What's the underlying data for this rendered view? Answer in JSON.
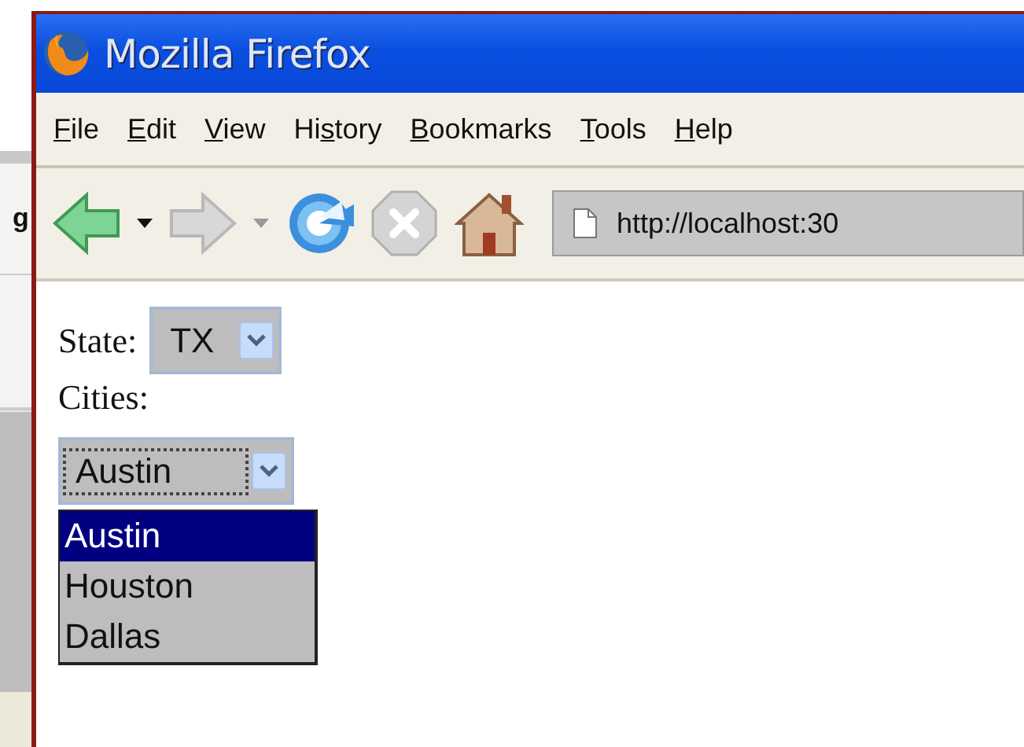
{
  "background_window": {
    "text": "g"
  },
  "window": {
    "title": "Mozilla Firefox"
  },
  "menu": [
    {
      "key": "F",
      "after": "ile"
    },
    {
      "key": "E",
      "after": "dit"
    },
    {
      "key": "V",
      "after": "iew"
    },
    {
      "before": "Hi",
      "key": "s",
      "after": "tory"
    },
    {
      "key": "B",
      "after": "ookmarks"
    },
    {
      "key": "T",
      "after": "ools"
    },
    {
      "key": "H",
      "after": "elp"
    }
  ],
  "toolbar": {
    "back_disabled": false,
    "forward_disabled": true,
    "stop_disabled": true,
    "address": "http://localhost:30"
  },
  "form": {
    "state_label": "State:",
    "state": "TX",
    "cities_label": "Cities:",
    "city": "Austin",
    "options": [
      {
        "label": "Austin",
        "selected": true
      },
      {
        "label": "Houston",
        "selected": false
      },
      {
        "label": "Dallas",
        "selected": false
      }
    ]
  }
}
